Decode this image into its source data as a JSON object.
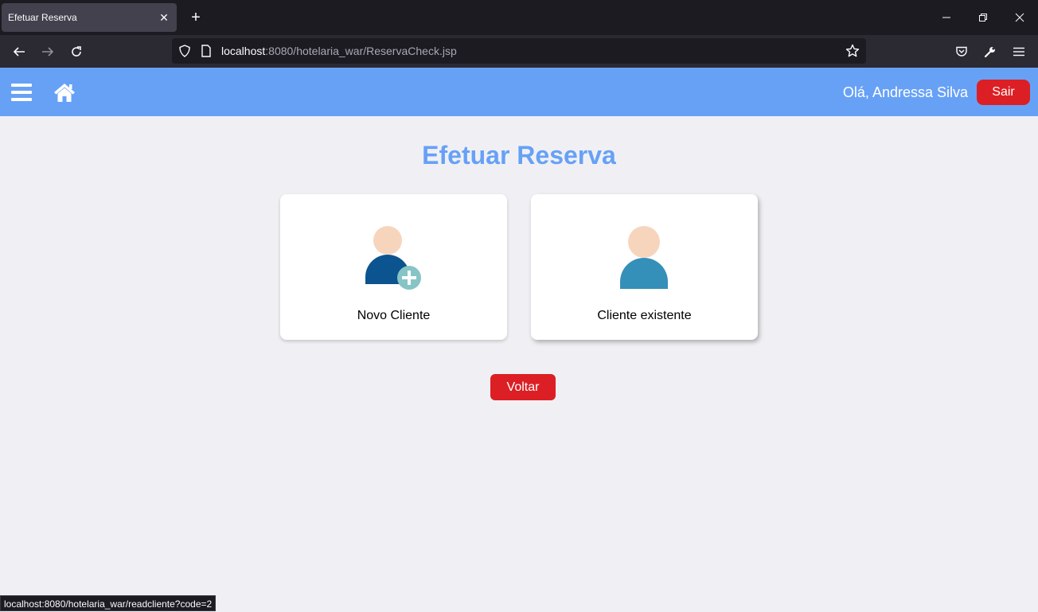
{
  "browser": {
    "tab_title": "Efetuar Reserva",
    "url_host": "localhost",
    "url_rest": ":8080/hotelaria_war/ReservaCheck.jsp",
    "status_url": "localhost:8080/hotelaria_war/readcliente?code=2"
  },
  "header": {
    "greeting": "Olá, Andressa Silva",
    "logout_label": "Sair",
    "bg_color": "#67a1f6"
  },
  "main": {
    "title": "Efetuar Reserva",
    "cards": [
      {
        "label": "Novo Cliente",
        "icon": "add-user-icon"
      },
      {
        "label": "Cliente existente",
        "icon": "user-icon"
      }
    ],
    "back_label": "Voltar"
  },
  "colors": {
    "accent": "#67a1f6",
    "danger": "#dc1f24",
    "background": "#f0f0f4"
  }
}
